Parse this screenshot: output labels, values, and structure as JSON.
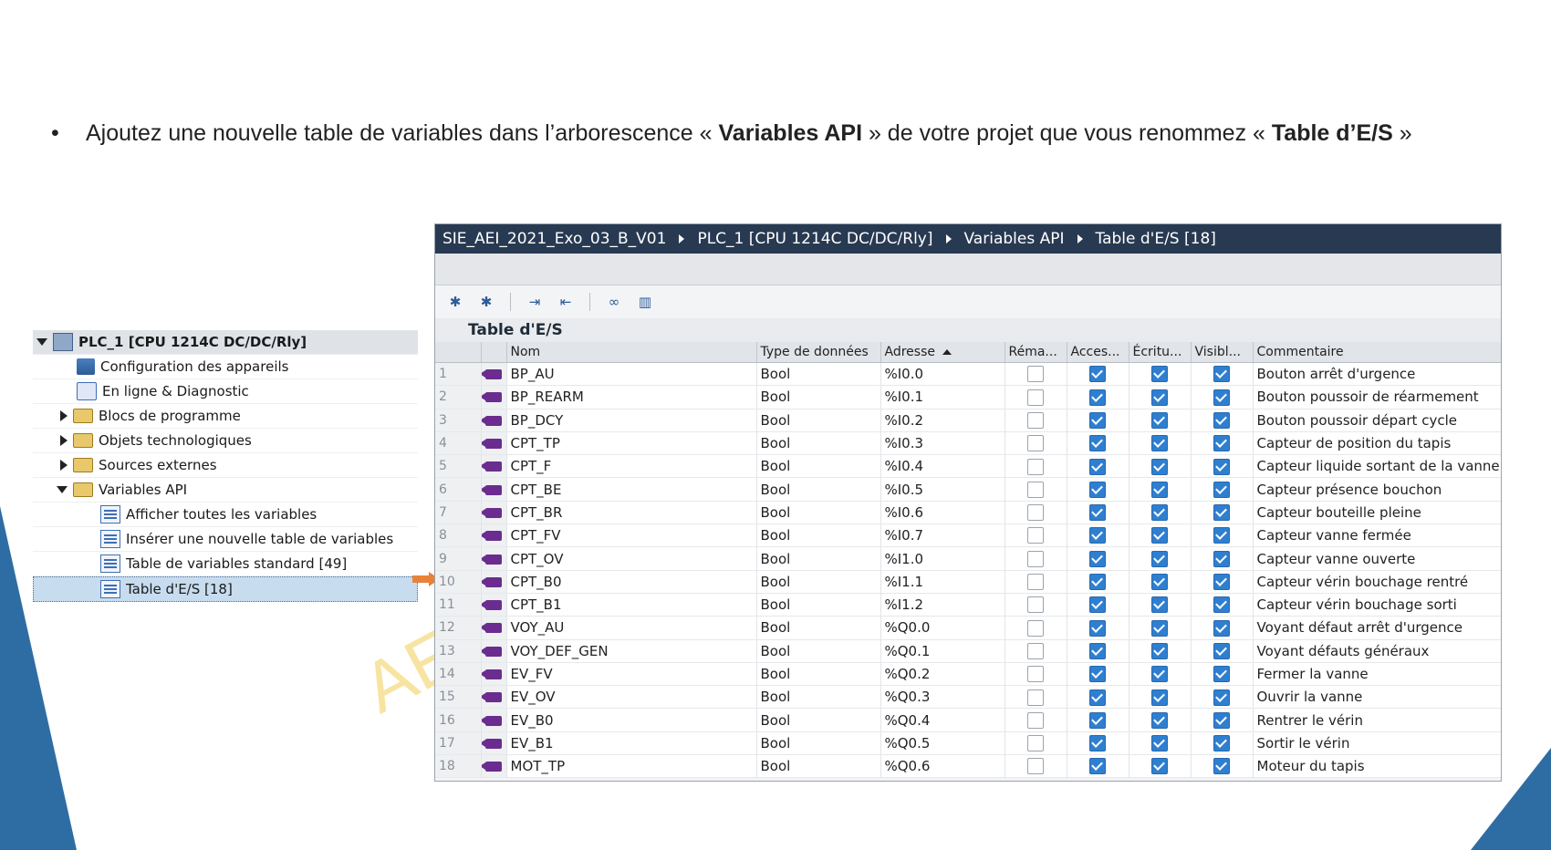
{
  "instruction": {
    "bullet": "•",
    "part1": "Ajoutez une nouvelle table de variables dans l’arborescence « ",
    "bold1": "Variables API",
    "part2": " » de votre projet que vous renommez « ",
    "bold2": "Table d’E/S",
    "part3": " »"
  },
  "watermark": "AE",
  "tree": {
    "root": "PLC_1 [CPU 1214C DC/DC/Rly]",
    "items": [
      {
        "label": "Configuration des appareils",
        "icon": "device-config-icon"
      },
      {
        "label": "En ligne & Diagnostic",
        "icon": "diagnostic-icon"
      },
      {
        "label": "Blocs de programme",
        "icon": "folder-icon"
      },
      {
        "label": "Objets technologiques",
        "icon": "folder-icon"
      },
      {
        "label": "Sources externes",
        "icon": "folder-icon"
      },
      {
        "label": "Variables API",
        "icon": "folder-icon"
      },
      {
        "label": "Afficher toutes les variables",
        "icon": "table-icon"
      },
      {
        "label": "Insérer une nouvelle table de variables",
        "icon": "table-add-icon"
      },
      {
        "label": "Table de variables standard [49]",
        "icon": "table-icon"
      },
      {
        "label": "Table d'E/S [18]",
        "icon": "table-icon"
      }
    ]
  },
  "editor": {
    "breadcrumb": [
      "SIE_AEI_2021_Exo_03_B_V01",
      "PLC_1 [CPU 1214C DC/DC/Rly]",
      "Variables API",
      "Table d'E/S [18]"
    ],
    "table_title": "Table d'E/S",
    "columns": [
      "",
      "",
      "Nom",
      "Type de données",
      "Adresse",
      "Réma...",
      "Acces...",
      "Écritu...",
      "Visibl...",
      "Commentaire"
    ],
    "rows": [
      {
        "n": "1",
        "name": "BP_AU",
        "type": "Bool",
        "addr": "%I0.0",
        "comment": "Bouton arrêt d'urgence"
      },
      {
        "n": "2",
        "name": "BP_REARM",
        "type": "Bool",
        "addr": "%I0.1",
        "comment": "Bouton poussoir de réarmement"
      },
      {
        "n": "3",
        "name": "BP_DCY",
        "type": "Bool",
        "addr": "%I0.2",
        "comment": "Bouton poussoir départ cycle"
      },
      {
        "n": "4",
        "name": "CPT_TP",
        "type": "Bool",
        "addr": "%I0.3",
        "comment": "Capteur de position du tapis"
      },
      {
        "n": "5",
        "name": "CPT_F",
        "type": "Bool",
        "addr": "%I0.4",
        "comment": "Capteur liquide sortant de la vanne"
      },
      {
        "n": "6",
        "name": "CPT_BE",
        "type": "Bool",
        "addr": "%I0.5",
        "comment": "Capteur présence bouchon"
      },
      {
        "n": "7",
        "name": "CPT_BR",
        "type": "Bool",
        "addr": "%I0.6",
        "comment": "Capteur bouteille pleine"
      },
      {
        "n": "8",
        "name": "CPT_FV",
        "type": "Bool",
        "addr": "%I0.7",
        "comment": "Capteur vanne fermée"
      },
      {
        "n": "9",
        "name": "CPT_OV",
        "type": "Bool",
        "addr": "%I1.0",
        "comment": "Capteur vanne ouverte"
      },
      {
        "n": "10",
        "name": "CPT_B0",
        "type": "Bool",
        "addr": "%I1.1",
        "comment": "Capteur vérin bouchage rentré"
      },
      {
        "n": "11",
        "name": "CPT_B1",
        "type": "Bool",
        "addr": "%I1.2",
        "comment": "Capteur vérin bouchage sorti"
      },
      {
        "n": "12",
        "name": "VOY_AU",
        "type": "Bool",
        "addr": "%Q0.0",
        "comment": "Voyant défaut arrêt d'urgence"
      },
      {
        "n": "13",
        "name": "VOY_DEF_GEN",
        "type": "Bool",
        "addr": "%Q0.1",
        "comment": "Voyant défauts généraux"
      },
      {
        "n": "14",
        "name": "EV_FV",
        "type": "Bool",
        "addr": "%Q0.2",
        "comment": "Fermer la vanne"
      },
      {
        "n": "15",
        "name": "EV_OV",
        "type": "Bool",
        "addr": "%Q0.3",
        "comment": "Ouvrir la vanne"
      },
      {
        "n": "16",
        "name": "EV_B0",
        "type": "Bool",
        "addr": "%Q0.4",
        "comment": "Rentrer le vérin"
      },
      {
        "n": "17",
        "name": "EV_B1",
        "type": "Bool",
        "addr": "%Q0.5",
        "comment": "Sortir le vérin"
      },
      {
        "n": "18",
        "name": "MOT_TP",
        "type": "Bool",
        "addr": "%Q0.6",
        "comment": "Moteur du tapis"
      }
    ]
  },
  "colors": {
    "breadcrumb_bg": "#283a52",
    "accent": "#2e6da4",
    "checkbox_on": "#2f7fd0",
    "tag_icon": "#6b2c8f"
  }
}
